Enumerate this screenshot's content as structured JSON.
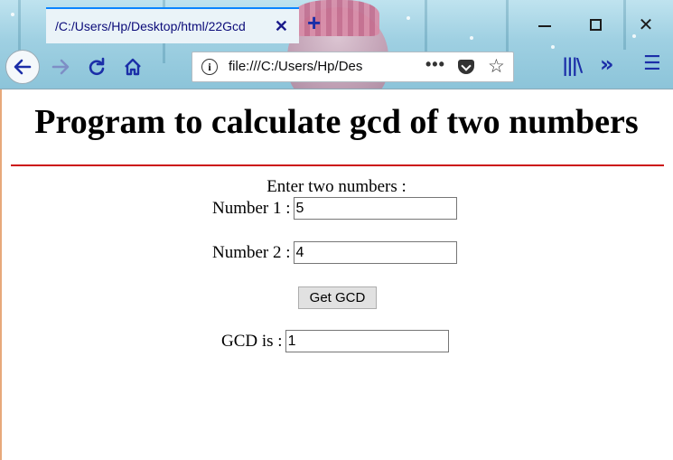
{
  "browser": {
    "tab_title": "/C:/Users/Hp/Desktop/html/22Gcd",
    "tab_close": "✕",
    "new_tab": "+",
    "url": "file:///C:/Users/Hp/Des",
    "more": "•••",
    "icons": [
      "back-arrow-icon",
      "forward-arrow-icon",
      "reload-icon",
      "home-icon",
      "info-icon",
      "more-icon",
      "pocket-icon",
      "star-icon",
      "library-icon",
      "overflow-icon",
      "menu-icon"
    ],
    "accent_color": "#1b2ea8"
  },
  "page": {
    "title": "Program to calculate gcd of two numbers",
    "prompt": "Enter two numbers :",
    "number1_label": "Number 1 :",
    "number1_value": "5",
    "number2_label": "Number 2 :",
    "number2_value": "4",
    "button_label": "Get GCD",
    "result_label": "GCD is :",
    "result_value": "1",
    "rule_color": "#cc1111"
  }
}
